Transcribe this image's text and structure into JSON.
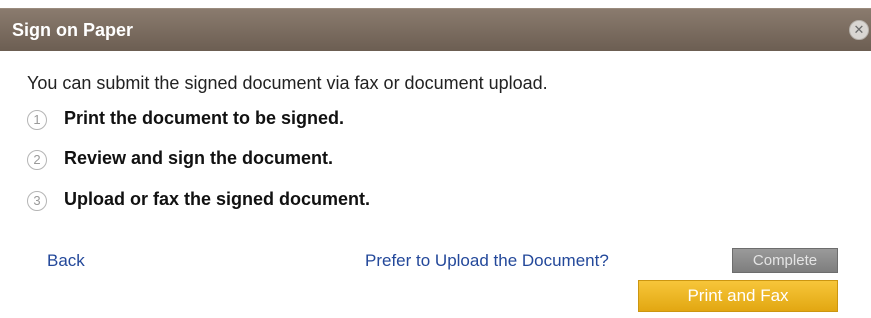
{
  "dialog": {
    "title": "Sign on Paper",
    "close_icon": "close-circle-icon",
    "intro": "You can submit the signed document via fax or document upload.",
    "steps": [
      {
        "number": "1",
        "text": "Print the document to be signed."
      },
      {
        "number": "2",
        "text": "Review and sign the document."
      },
      {
        "number": "3",
        "text": "Upload or fax the signed document."
      }
    ],
    "back_label": "Back",
    "upload_link_label": "Prefer to Upload the Document?",
    "complete_label": "Complete",
    "print_fax_label": "Print and Fax"
  },
  "colors": {
    "titlebar": "#7b6c5f",
    "link": "#23489a",
    "primary_button": "#f0b72a",
    "disabled_button": "#8a8a8a"
  }
}
